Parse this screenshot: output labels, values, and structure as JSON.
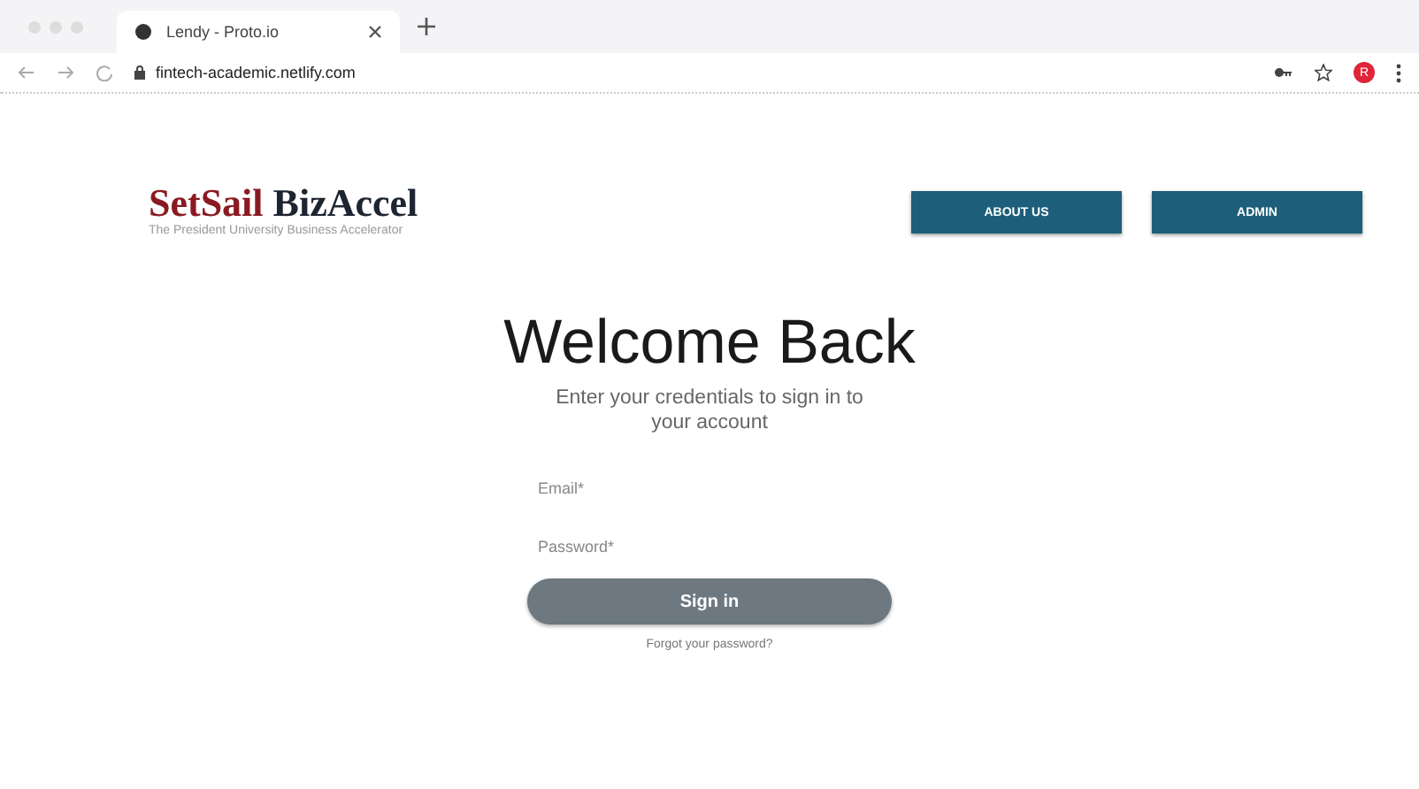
{
  "browser": {
    "tab_title": "Lendy - Proto.io",
    "address": "fintech-academic.netlify.com",
    "profile_initial": "R"
  },
  "header": {
    "logo_part_1": "SetSail",
    "logo_part_2": "BizAccel",
    "tagline": "The President University Business Accelerator",
    "buttons": [
      "ABOUT US",
      "ADMIN"
    ]
  },
  "login": {
    "title": "Welcome Back",
    "subtitle": "Enter your credentials to sign in to your account",
    "fields": [
      {
        "placeholder": "Email*"
      },
      {
        "placeholder": "Password*"
      }
    ],
    "submit": "Sign in",
    "forgot_link": "Forgot your password?"
  }
}
